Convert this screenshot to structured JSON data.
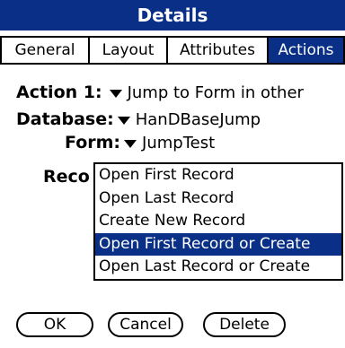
{
  "title": "Details",
  "tabs": [
    {
      "label": "General"
    },
    {
      "label": "Layout"
    },
    {
      "label": "Attributes"
    },
    {
      "label": "Actions",
      "active": true
    }
  ],
  "fields": {
    "action1": {
      "label": "Action 1:",
      "value": "Jump to Form in other"
    },
    "database": {
      "label": "Database:",
      "value": "HanDBaseJump"
    },
    "form": {
      "label": "Form:",
      "value": "JumpTest"
    },
    "record": {
      "label": "Reco"
    }
  },
  "dropdown": {
    "options": [
      "Open First Record",
      "Open Last Record",
      "Create New Record",
      "Open First Record or Create",
      "Open Last Record or Create"
    ],
    "selected": "Open First Record or Create"
  },
  "buttons": {
    "ok": "OK",
    "cancel": "Cancel",
    "delete": "Delete"
  },
  "colors": {
    "accent": "#0a2f86"
  }
}
